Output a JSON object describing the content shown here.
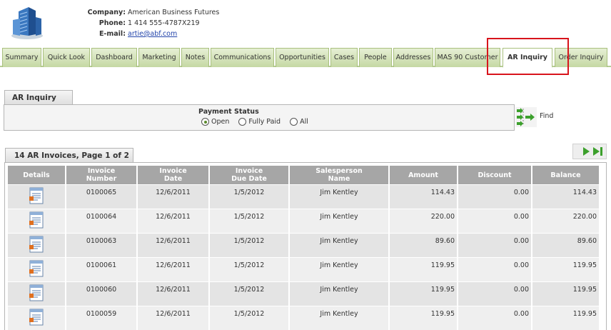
{
  "company": {
    "company_label": "Company:",
    "company_value": "American Business Futures",
    "phone_label": "Phone:",
    "phone_value": "1 414 555-4787X219",
    "email_label": "E-mail:",
    "email_value": "artie@abf.com"
  },
  "tabs": [
    {
      "label": "Summary"
    },
    {
      "label": "Quick Look"
    },
    {
      "label": "Dashboard"
    },
    {
      "label": "Marketing"
    },
    {
      "label": "Notes"
    },
    {
      "label": "Communications"
    },
    {
      "label": "Opportunities"
    },
    {
      "label": "Cases"
    },
    {
      "label": "People"
    },
    {
      "label": "Addresses"
    },
    {
      "label": "MAS 90 Customer"
    },
    {
      "label": "AR Inquiry"
    },
    {
      "label": "Order Inquiry"
    }
  ],
  "active_tab": "AR Inquiry",
  "inquiry": {
    "panel_title": "AR Inquiry",
    "payment_status_label": "Payment Status",
    "options": [
      {
        "label": "Open",
        "checked": true
      },
      {
        "label": "Fully Paid",
        "checked": false
      },
      {
        "label": "All",
        "checked": false
      }
    ],
    "find_label": "Find"
  },
  "results": {
    "title": "14 AR Invoices, Page 1 of 2",
    "columns": [
      {
        "line1": "Details",
        "line2": ""
      },
      {
        "line1": "Invoice",
        "line2": "Number"
      },
      {
        "line1": "Invoice",
        "line2": "Date"
      },
      {
        "line1": "Invoice",
        "line2": "Due Date"
      },
      {
        "line1": "Salesperson",
        "line2": "Name"
      },
      {
        "line1": "Amount",
        "line2": ""
      },
      {
        "line1": "Discount",
        "line2": ""
      },
      {
        "line1": "Balance",
        "line2": ""
      }
    ],
    "rows": [
      {
        "number": "0100065",
        "date": "12/6/2011",
        "due": "1/5/2012",
        "salesperson": "Jim Kentley",
        "amount": "114.43",
        "discount": "0.00",
        "balance": "114.43"
      },
      {
        "number": "0100064",
        "date": "12/6/2011",
        "due": "1/5/2012",
        "salesperson": "Jim Kentley",
        "amount": "220.00",
        "discount": "0.00",
        "balance": "220.00"
      },
      {
        "number": "0100063",
        "date": "12/6/2011",
        "due": "1/5/2012",
        "salesperson": "Jim Kentley",
        "amount": "89.60",
        "discount": "0.00",
        "balance": "89.60"
      },
      {
        "number": "0100061",
        "date": "12/6/2011",
        "due": "1/5/2012",
        "salesperson": "Jim Kentley",
        "amount": "119.95",
        "discount": "0.00",
        "balance": "119.95"
      },
      {
        "number": "0100060",
        "date": "12/6/2011",
        "due": "1/5/2012",
        "salesperson": "Jim Kentley",
        "amount": "119.95",
        "discount": "0.00",
        "balance": "119.95"
      },
      {
        "number": "0100059",
        "date": "12/6/2011",
        "due": "1/5/2012",
        "salesperson": "Jim Kentley",
        "amount": "119.95",
        "discount": "0.00",
        "balance": "119.95"
      }
    ]
  },
  "colors": {
    "tab_green": "#c5d8a4",
    "header_gray": "#a6a6a6",
    "highlight_red": "#d8141c"
  }
}
